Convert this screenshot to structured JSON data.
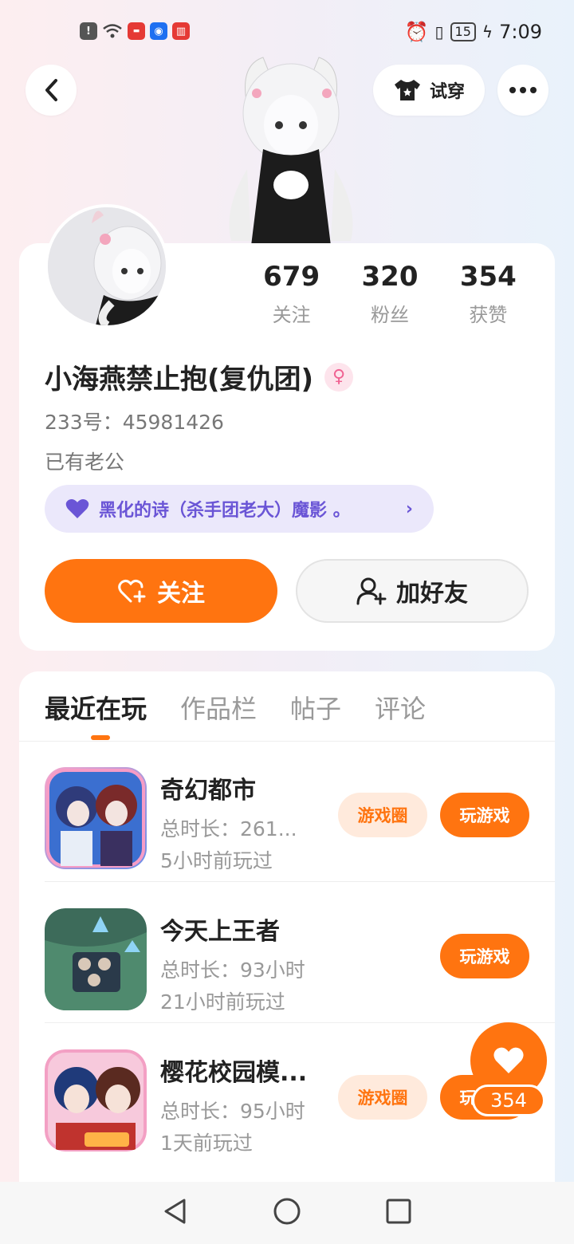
{
  "status_bar": {
    "battery": "15",
    "time": "7:09"
  },
  "header": {
    "try_on_label": "试穿"
  },
  "profile": {
    "stats": [
      {
        "value": "679",
        "label": "关注"
      },
      {
        "value": "320",
        "label": "粉丝"
      },
      {
        "value": "354",
        "label": "获赞"
      }
    ],
    "nickname": "小海燕禁止抱(复仇团)",
    "gender_symbol": "♀",
    "uid": "233号：45981426",
    "signature": "已有老公",
    "relation": "黑化的诗（杀手团老大）魔影 。",
    "follow_label": "关注",
    "add_friend_label": "加好友"
  },
  "tabs": [
    "最近在玩",
    "作品栏",
    "帖子",
    "评论"
  ],
  "games": [
    {
      "name": "奇幻都市",
      "time": "总时长：261...",
      "last_played": "5小时前玩过",
      "circle_label": "游戏圈",
      "play_label": "玩游戏"
    },
    {
      "name": "今天上王者",
      "time": "总时长：93小时",
      "last_played": "21小时前玩过",
      "play_label": "玩游戏"
    },
    {
      "name": "樱花校园模...",
      "time": "总时长：95小时",
      "last_played": "1天前玩过",
      "circle_label": "游戏圈",
      "play_label": "玩游戏"
    }
  ],
  "floating_like": {
    "count": "354"
  },
  "colors": {
    "accent": "#ff7410",
    "accent_light": "#ffeadc",
    "relation_bg": "#ebe8fb",
    "relation_text": "#6a55d6"
  }
}
